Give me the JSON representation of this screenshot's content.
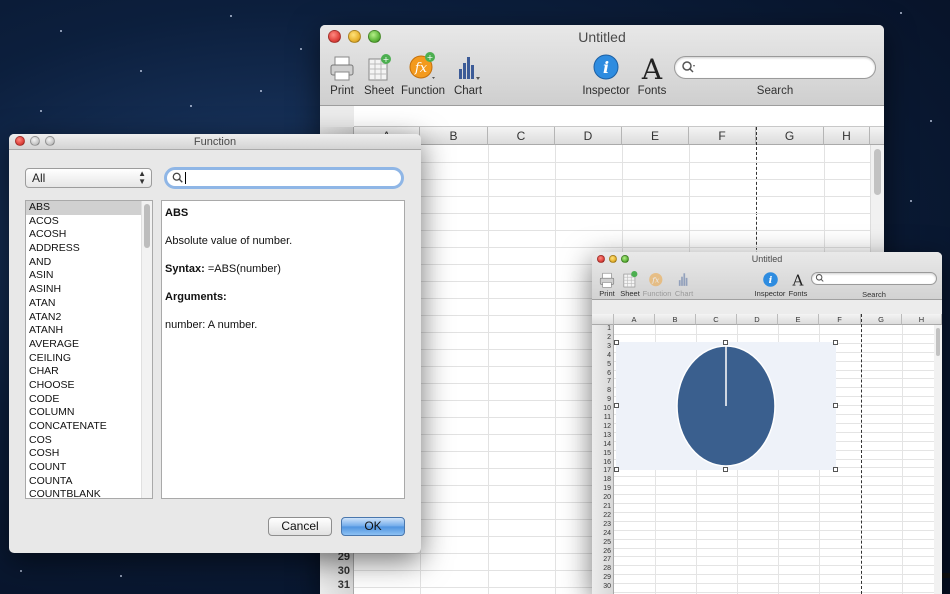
{
  "main_window": {
    "title": "Untitled",
    "toolbar": {
      "print": "Print",
      "sheet": "Sheet",
      "function": "Function",
      "chart": "Chart",
      "inspector": "Inspector",
      "fonts": "Fonts",
      "search": "Search"
    },
    "columns": [
      "A",
      "B",
      "C",
      "D",
      "E",
      "F",
      "G",
      "H"
    ],
    "row_numbers": [
      "29",
      "30",
      "31"
    ]
  },
  "function_dialog": {
    "title": "Function",
    "category_selected": "All",
    "search_value": "",
    "functions": [
      "ABS",
      "ACOS",
      "ACOSH",
      "ADDRESS",
      "AND",
      "ASIN",
      "ASINH",
      "ATAN",
      "ATAN2",
      "ATANH",
      "AVERAGE",
      "CEILING",
      "CHAR",
      "CHOOSE",
      "CODE",
      "COLUMN",
      "CONCATENATE",
      "COS",
      "COSH",
      "COUNT",
      "COUNTA",
      "COUNTBLANK"
    ],
    "selected_function": "ABS",
    "description": {
      "name": "ABS",
      "summary": "Absolute value of number.",
      "syntax_label": "Syntax:",
      "syntax": "=ABS(number)",
      "arguments_label": "Arguments:",
      "argument_text": "number: A number."
    },
    "cancel_label": "Cancel",
    "ok_label": "OK"
  },
  "chart_window": {
    "title": "Untitled",
    "toolbar": {
      "print": "Print",
      "sheet": "Sheet",
      "function": "Function",
      "chart": "Chart",
      "inspector": "Inspector",
      "fonts": "Fonts",
      "search": "Search"
    },
    "columns": [
      "A",
      "B",
      "C",
      "D",
      "E",
      "F",
      "G",
      "H"
    ],
    "row_numbers": [
      "1",
      "2",
      "3",
      "4",
      "5",
      "6",
      "7",
      "8",
      "9",
      "10",
      "11",
      "12",
      "13",
      "14",
      "15",
      "16",
      "17",
      "18",
      "19",
      "20",
      "21",
      "22",
      "23",
      "24",
      "25",
      "26",
      "27",
      "28",
      "29",
      "30"
    ],
    "pie": {
      "fill": "#3a5f8e",
      "slice_fraction": 1.0
    }
  }
}
